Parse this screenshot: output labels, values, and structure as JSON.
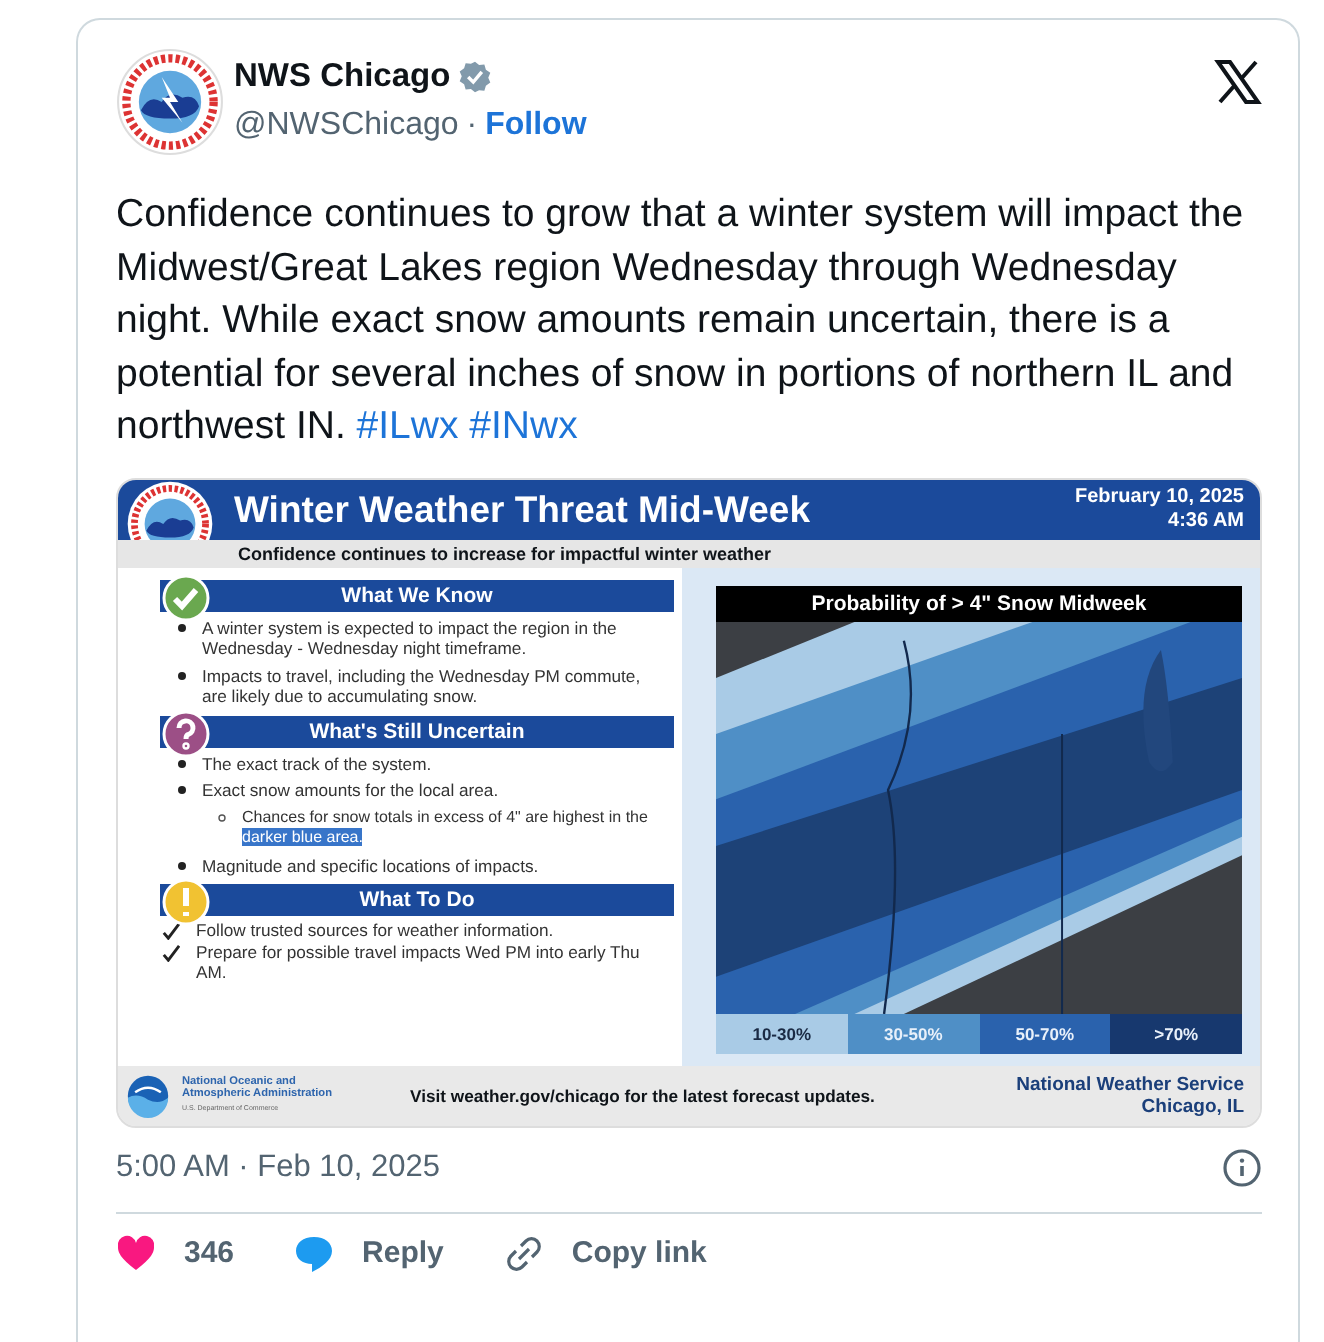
{
  "account": {
    "name": "NWS Chicago",
    "verified": true,
    "handle": "@NWSChicago",
    "separator": "·",
    "follow": "Follow"
  },
  "tweet": {
    "text": "Confidence continues to grow that a winter system will impact the Midwest/Great Lakes region Wednesday through Wednesday night. While exact snow amounts remain uncertain, there is a potential for several inches of snow in portions of northern IL and northwest IN.",
    "hashtags": [
      "#ILwx",
      "#INwx"
    ]
  },
  "graphic": {
    "title": "Winter Weather Threat Mid-Week",
    "date": "February 10, 2025",
    "time": "4:36 AM",
    "subtitle": "Confidence continues to increase for impactful winter weather",
    "sections": [
      {
        "kind": "know",
        "heading": "What We Know",
        "items": [
          {
            "kind": "bullet",
            "text": "A winter system is expected to impact the region in the Wednesday - Wednesday night timeframe."
          },
          {
            "kind": "bullet",
            "text": "Impacts to travel, including the Wednesday PM commute, are likely due to accumulating snow."
          }
        ]
      },
      {
        "kind": "uncertain",
        "heading": "What's Still Uncertain",
        "items": [
          {
            "kind": "bullet",
            "text": "The exact track of the system."
          },
          {
            "kind": "bullet",
            "text": "Exact snow amounts for the local area."
          },
          {
            "kind": "sub",
            "text": "Chances for snow totals in excess of 4\" are highest in the ",
            "highlight": "darker blue area."
          },
          {
            "kind": "bullet",
            "text": "Magnitude and specific locations of impacts."
          }
        ]
      },
      {
        "kind": "todo",
        "heading": "What To Do",
        "items": [
          {
            "kind": "check",
            "text": "Follow trusted sources for weather information."
          },
          {
            "kind": "check",
            "text": "Prepare for possible travel impacts Wed PM into early Thu AM."
          }
        ]
      }
    ],
    "map_title": "Probability of > 4\" Snow Midweek",
    "legend": [
      {
        "label": "10-30%",
        "color": "#a9cbe6"
      },
      {
        "label": "30-50%",
        "color": "#4f8fc6"
      },
      {
        "label": "50-70%",
        "color": "#2a62ad"
      },
      {
        "label": ">70%",
        "color": "#17386e"
      }
    ],
    "noaa": [
      "National Oceanic and",
      "Atmospheric Administration",
      "U.S. Department of Commerce"
    ],
    "footer": "Visit weather.gov/chicago for the latest forecast updates.",
    "office": [
      "National Weather Service",
      "Chicago, IL"
    ]
  },
  "timestamp": "5:00 AM · Feb 10, 2025",
  "actions": [
    {
      "kind": "like",
      "label": "346"
    },
    {
      "kind": "reply",
      "label": "Reply"
    },
    {
      "kind": "link",
      "label": "Copy link"
    }
  ]
}
